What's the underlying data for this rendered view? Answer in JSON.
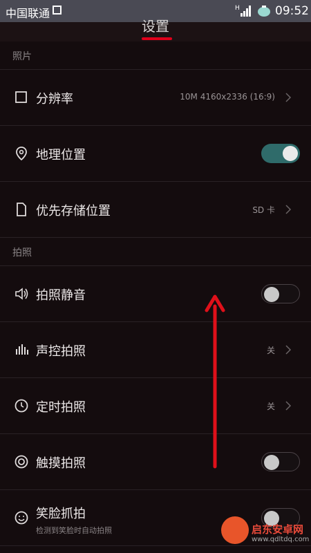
{
  "status_bar": {
    "carrier": "中国联通",
    "time": "09:52",
    "network": "H"
  },
  "header": {
    "title": "设置"
  },
  "sections": [
    {
      "header": "照片",
      "items": [
        {
          "label": "分辨率",
          "value": "10M 4160x2336 (16:9)",
          "icon": "square-icon"
        },
        {
          "label": "地理位置",
          "toggle": true,
          "icon": "location-pin-icon"
        },
        {
          "label": "优先存储位置",
          "value": "SD 卡",
          "icon": "file-icon"
        }
      ]
    },
    {
      "header": "拍照",
      "items": [
        {
          "label": "拍照静音",
          "toggle": false,
          "icon": "speaker-icon"
        },
        {
          "label": "声控拍照",
          "value": "关",
          "icon": "sound-bars-icon"
        },
        {
          "label": "定时拍照",
          "value": "关",
          "icon": "clock-icon"
        },
        {
          "label": "触摸拍照",
          "toggle": false,
          "icon": "target-icon"
        },
        {
          "label": "笑脸抓拍",
          "sublabel": "检测到笑脸时自动拍照",
          "toggle": false,
          "icon": "smile-icon"
        }
      ]
    }
  ],
  "watermark": {
    "name": "启东安卓网",
    "url": "www.qdltdq.com"
  },
  "colors": {
    "accent_red": "#e0001b",
    "toggle_on": "#2f6b6a",
    "background": "#140c0e"
  }
}
